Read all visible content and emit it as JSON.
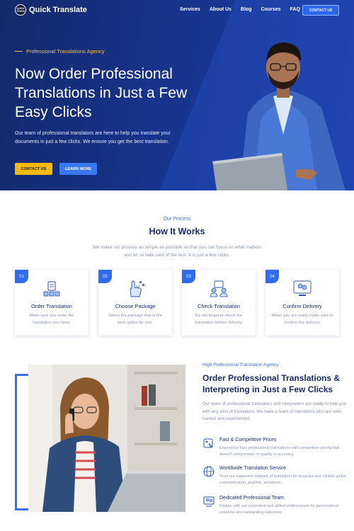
{
  "nav": {
    "logo_badge": "QUICK TRANS",
    "logo_text": "Quick Translate",
    "links": [
      "Services",
      "About Us",
      "Blog",
      "Courses",
      "FAQ"
    ],
    "cta": "CONTACT US"
  },
  "hero": {
    "eyebrow": "Professional Translations Agency",
    "title": "Now Order Professional Translations in Just a Few Easy Clicks",
    "description": "Our team of professional translators are here to help you translate your documents in just a few clicks. We ensure you get the best translation.",
    "primary_button": "CONTACT US",
    "secondary_button": "LEARN MORE"
  },
  "process": {
    "eyebrow": "Our Process",
    "title": "How It Works",
    "description": "We make our process as simple as possible so that you can focus on what matters and let us take care of the rest. It is just a few clicks.",
    "steps": [
      {
        "num": "01",
        "title": "Order Translation",
        "desc": "Make sure you order the translation you need.",
        "icon": "document-order-icon"
      },
      {
        "num": "02",
        "title": "Choose Package",
        "desc": "Select the package that is the best option for you.",
        "icon": "hand-select-icon"
      },
      {
        "num": "03",
        "title": "Check Translation",
        "desc": "Do not forget to check the translation before delivery.",
        "icon": "people-review-icon"
      },
      {
        "num": "04",
        "title": "Confirm Delivery",
        "desc": "When you are ready make sure to confirm the delivery.",
        "icon": "screen-chat-icon"
      }
    ]
  },
  "about": {
    "eyebrow": "High Professional Translation Agency",
    "title": "Order Professional Translations & Interpreting in Just a Few Clicks",
    "description": "Our team of professional translators and interpreters are ready to help you with any kind of translation. We have a team of translators who are well-trained and experienced.",
    "features": [
      {
        "title": "Fast & Competitive Prices",
        "desc": "Experience fast, professional translations with competitive pricing that doesn't compromise on quality or accuracy.",
        "icon": "price-tag-icon"
      },
      {
        "title": "Worldwide Translation Service",
        "desc": "Trust our expansive network of translators for accurate and reliable global communication, anytime, anywhere.",
        "icon": "globe-icon"
      },
      {
        "title": "Dedicated Professional Team",
        "desc": "Partner with our committed and skilled professionals for personalized solutions and outstanding outcomes.",
        "icon": "team-icon"
      }
    ]
  },
  "colors": {
    "hero_bg": "#17338a",
    "accent_blue": "#2f6cf0",
    "accent_yellow": "#f5b90f",
    "heading": "#182a6b"
  }
}
